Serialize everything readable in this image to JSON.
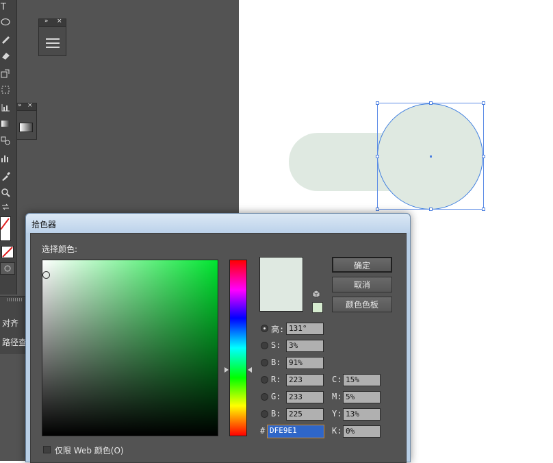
{
  "colors": {
    "selected": "#DFE9E1",
    "selection_blue": "#4a7ee0"
  },
  "toolbar": {
    "icons": [
      "type-tool-icon",
      "ellipse-tool-icon",
      "pencil-tool-icon",
      "eraser-tool-icon",
      "scale-tool-icon",
      "free-transform-icon",
      "chart-tool-icon",
      "gradient-tool-icon",
      "blend-tool-icon",
      "bar-graph-icon",
      "eyedropper-tool-icon",
      "zoom-tool-icon",
      "swap-colors-icon",
      "stroke-swatch-icon",
      "none-swatch-icon",
      "draw-mode-icon"
    ],
    "type_glyph": "T"
  },
  "align_panel": {
    "label": "对齐",
    "pathfinder_label": "路径查"
  },
  "dialog": {
    "title": "拾色器",
    "select_color_label": "选择颜色:",
    "buttons": {
      "ok": "确定",
      "cancel": "取消",
      "swatches": "颜色色板"
    },
    "hsb": [
      {
        "label": "高:",
        "value": "131°",
        "selected": true
      },
      {
        "label": "S:",
        "value": "3%",
        "selected": false
      },
      {
        "label": "B:",
        "value": "91%",
        "selected": false
      }
    ],
    "rgb": [
      {
        "label": "R:",
        "value": "223"
      },
      {
        "label": "G:",
        "value": "233"
      },
      {
        "label": "B:",
        "value": "225"
      }
    ],
    "cmyk": [
      {
        "label": "C:",
        "value": "15%"
      },
      {
        "label": "M:",
        "value": "5%"
      },
      {
        "label": "Y:",
        "value": "13%"
      },
      {
        "label": "K:",
        "value": "0%"
      }
    ],
    "hex_label": "#",
    "hex_value": "DFE9E1",
    "websafe_label": "仅限 Web 颜色(O)"
  }
}
